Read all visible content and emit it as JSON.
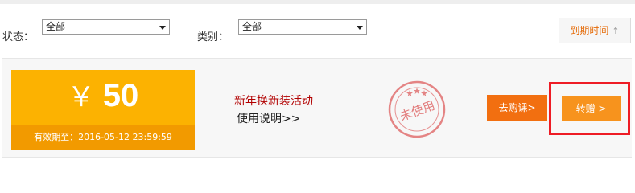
{
  "filters": {
    "status": {
      "label": "状态：",
      "value": "全部"
    },
    "category": {
      "label": "类别：",
      "value": "全部"
    },
    "sort_label": "到期时间",
    "sort_icon": "arrow-up-icon"
  },
  "coupon": {
    "currency": "￥",
    "amount": "50",
    "validity": "有效期至：2016-05-12 23:59:59",
    "activity": "新年换新装活动",
    "usage_link": "使用说明>>",
    "stamp_text": "未使用",
    "buy_button": "去购课>",
    "transfer_button": "转赠  >"
  },
  "colors": {
    "accent_orange": "#f26f10",
    "ticket_yellow": "#fcb201",
    "stamp_red": "#e07070",
    "highlight_red": "#ee1c25"
  }
}
